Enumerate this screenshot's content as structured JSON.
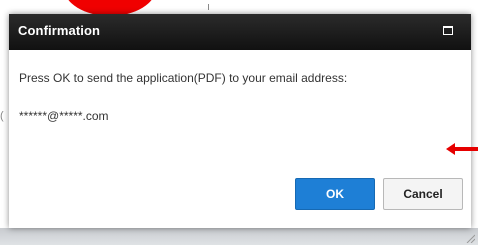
{
  "dialog": {
    "title": "Confirmation",
    "message": "Press OK to send the application(PDF) to your email address:",
    "email": "******@*****.com",
    "ok_label": "OK",
    "cancel_label": "Cancel",
    "maximize_icon": "maximize-icon"
  },
  "colors": {
    "titlebar": "#1c1c1c",
    "ok_button": "#1e7fd6",
    "annotation_red": "#f00000"
  },
  "annotations": {
    "circle_icon": "red-circle-annotation",
    "arrow_icon": "red-arrow-left-icon"
  }
}
